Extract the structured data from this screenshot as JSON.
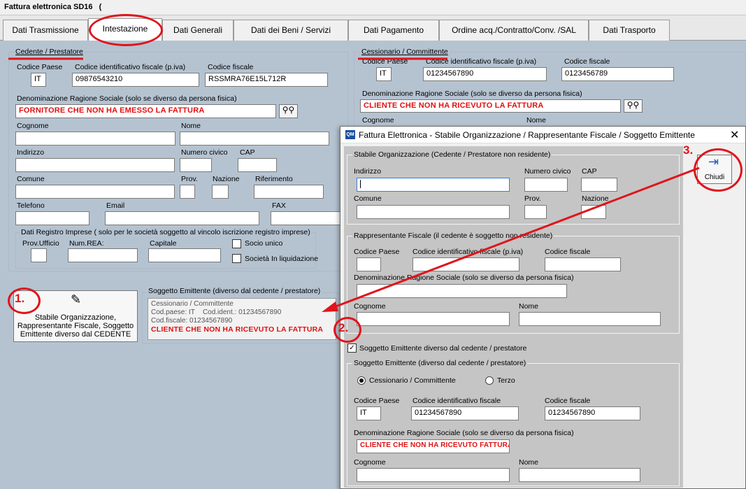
{
  "app": {
    "title": "Fattura elettronica SD16"
  },
  "tabs": [
    "Dati Trasmissione",
    "Intestazione",
    "Dati Generali",
    "Dati dei Beni / Servizi",
    "Dati Pagamento",
    "Ordine acq./Contratto/Conv. /SAL",
    "Dati Trasporto"
  ],
  "cedente": {
    "title": "Cedente / Prestatore",
    "codice_paese_label": "Codice Paese",
    "codice_paese": "IT",
    "piva_label": "Codice identificativo fiscale (p.iva)",
    "piva": "09876543210",
    "cf_label": "Codice fiscale",
    "cf": "RSSMRA76E15L712R",
    "denom_label": "Denominazione Ragione Sociale (solo se diverso da persona fisica)",
    "denom": "FORNITORE CHE NON HA EMESSO LA FATTURA",
    "cognome_label": "Cognome",
    "nome_label": "Nome",
    "indirizzo_label": "Indirizzo",
    "civico_label": "Numero civico",
    "cap_label": "CAP",
    "comune_label": "Comune",
    "prov_label": "Prov.",
    "nazione_label": "Nazione",
    "riferimento_label": "Riferimento",
    "telefono_label": "Telefono",
    "email_label": "Email",
    "fax_label": "FAX"
  },
  "registro": {
    "title": "Dati Registro Imprese ( solo per le società soggetto al vincolo iscrizione registro imprese)",
    "ufficio_label": "Prov.Ufficio",
    "rea_label": "Num.REA:",
    "capitale_label": "Capitale",
    "socio_label": "Socio unico",
    "liquidazione_label": "Società In liquidazione"
  },
  "stabile_button": {
    "label": "Stabile Organizzazione, Rappresentante Fiscale, Soggetto Emittente diverso dal CEDENTE"
  },
  "soggetto_box": {
    "title": "Soggetto Emittente (diverso dal cedente / prestatore)",
    "line1": "Cessionario / Committente",
    "line2a": "Cod.paese: IT",
    "line2b": "Cod.ident.: 01234567890",
    "line3": "Cod.fiscale: 01234567890",
    "line4": "CLIENTE CHE NON HA RICEVUTO LA FATTURA"
  },
  "cessionario": {
    "title": "Cessionario / Committente",
    "codice_paese_label": "Codice Paese",
    "codice_paese": "IT",
    "piva_label": "Codice identificativo fiscale (p.iva)",
    "piva": "01234567890",
    "cf_label": "Codice fiscale",
    "cf": "0123456789",
    "denom_label": "Denominazione Ragione Sociale  (solo se diverso da persona fisica)",
    "denom": "CLIENTE CHE NON HA RICEVUTO LA FATTURA",
    "cognome_label": "Cognome",
    "nome_label": "Nome"
  },
  "dialog": {
    "title": "Fattura Elettronica - Stabile Organizzazione / Rappresentante Fiscale / Soggetto Emittente",
    "close_label": "Chiudi",
    "stabile": {
      "title": "Stabile Organizzazione (Cedente / Prestatore non residente)",
      "indirizzo_label": "Indirizzo",
      "civico_label": "Numero civico",
      "cap_label": "CAP",
      "comune_label": "Comune",
      "prov_label": "Prov.",
      "nazione_label": "Nazione"
    },
    "rappresentante": {
      "title": "Rappresentante Fiscale (il cedente è soggetto non residente)",
      "codice_paese_label": "Codice Paese",
      "piva_label": "Codice identificativo fiscale (p.iva)",
      "cf_label": "Codice fiscale",
      "denom_label": "Denominazione Ragione Sociale  (solo se diverso da persona fisica)",
      "cognome_label": "Cognome",
      "nome_label": "Nome"
    },
    "checkbox_label": "Soggetto Emittente diverso dal cedente / prestatore",
    "emittente": {
      "title": "Soggetto Emittente (diverso dal cedente / prestatore)",
      "radio1": "Cessionario / Committente",
      "radio2": "Terzo",
      "codice_paese_label": "Codice Paese",
      "codice_paese": "IT",
      "piva_label": "Codice identificativo fiscale",
      "piva": "01234567890",
      "cf_label": "Codice fiscale",
      "cf": "01234567890",
      "denom_label": "Denominazione Ragione Sociale  (solo se diverso da persona fisica)",
      "denom": "CLIENTE CHE NON HA RICEVUTO FATTURA",
      "cognome_label": "Cognome",
      "nome_label": "Nome"
    }
  },
  "annotations": {
    "a1": "1.",
    "a2": "2.",
    "a3": "3."
  },
  "colors": {
    "accent_red": "#e0141b",
    "panel": "#b5c3d1"
  }
}
